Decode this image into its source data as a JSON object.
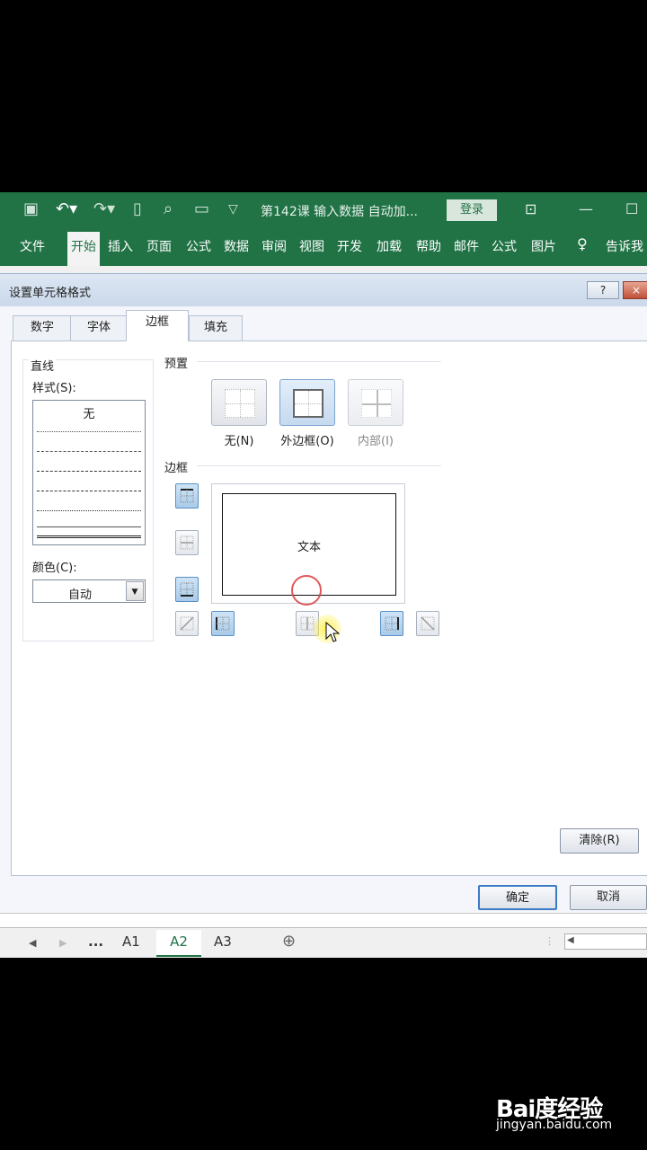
{
  "titlebar": {
    "doc_title": "第142课 输入数据 自动加...",
    "login_label": "登录"
  },
  "ribbon": {
    "tabs": [
      "文件",
      "开始",
      "插入",
      "页面",
      "公式",
      "数据",
      "审阅",
      "视图",
      "开发",
      "加载",
      "帮助",
      "邮件",
      "公式",
      "图片"
    ],
    "active_index": 1,
    "tell_me": "告诉我"
  },
  "dialog": {
    "title": "设置单元格格式",
    "help": "?",
    "close": "×",
    "tabs": [
      "数字",
      "字体",
      "边框",
      "填充"
    ],
    "active_tab": "边框",
    "line": {
      "heading": "直线",
      "style_label": "样式(S):",
      "none": "无",
      "color_label": "颜色(C):",
      "color_value": "自动"
    },
    "presets": {
      "heading": "预置",
      "none": "无(N)",
      "outline": "外边框(O)",
      "inside": "内部(I)"
    },
    "border": {
      "heading": "边框",
      "preview_text": "文本"
    },
    "clear": "清除(R)",
    "ok": "确定",
    "cancel": "取消"
  },
  "sheets": {
    "ellipsis": "...",
    "tabs": [
      "A1",
      "A2",
      "A3"
    ],
    "active": "A2",
    "add": "⊕"
  },
  "watermark": {
    "logo": "Bai度经验",
    "url": "jingyan.baidu.com"
  }
}
